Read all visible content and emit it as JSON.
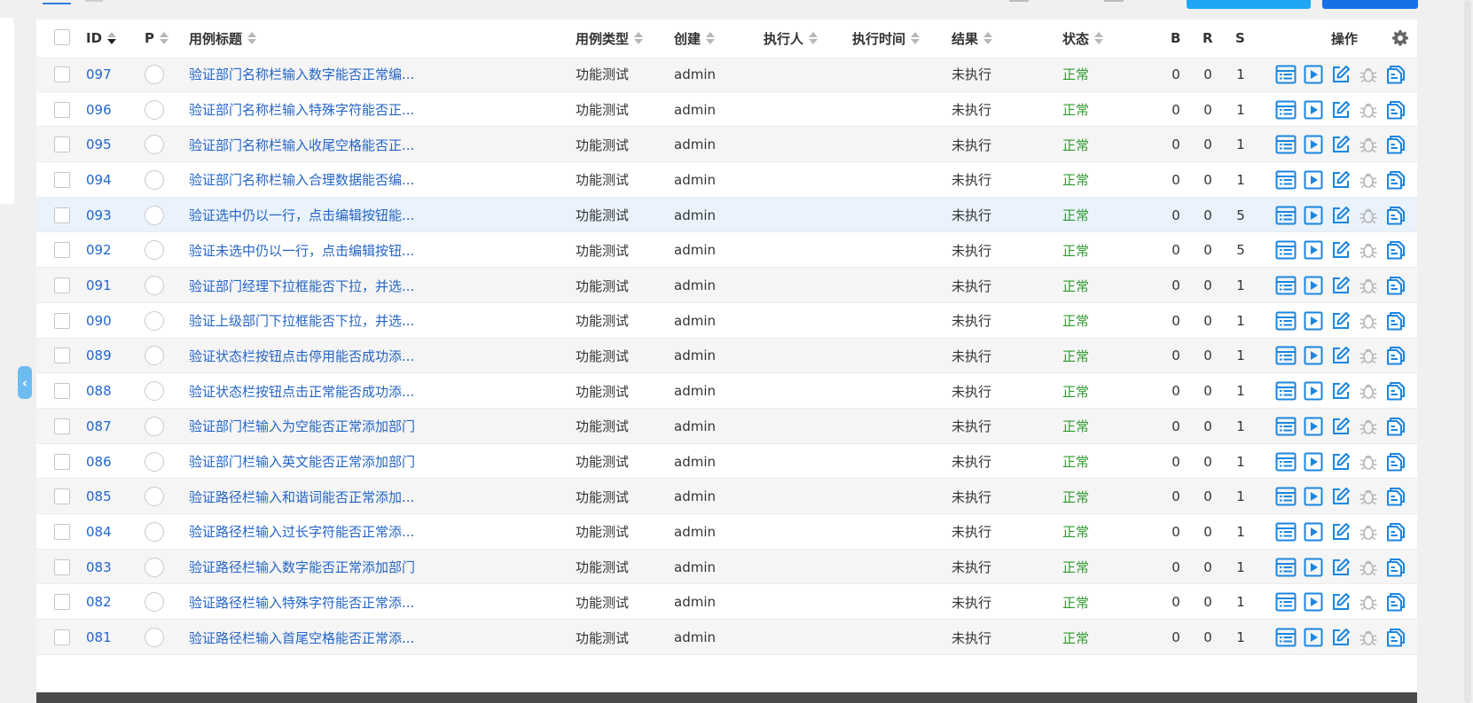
{
  "table": {
    "headers": {
      "id": "ID",
      "priority": "P",
      "title": "用例标题",
      "type": "用例类型",
      "creator": "创建",
      "executor": "执行人",
      "exec_time": "执行时间",
      "result": "结果",
      "status": "状态",
      "b": "B",
      "r": "R",
      "s": "S",
      "actions": "操作"
    },
    "rows": [
      {
        "id": "097",
        "title": "验证部门名称栏输入数字能否正常编...",
        "type": "功能测试",
        "creator": "admin",
        "executor": "",
        "exec_time": "",
        "result": "未执行",
        "status": "正常",
        "b": "0",
        "r": "0",
        "s": "1"
      },
      {
        "id": "096",
        "title": "验证部门名称栏输入特殊字符能否正...",
        "type": "功能测试",
        "creator": "admin",
        "executor": "",
        "exec_time": "",
        "result": "未执行",
        "status": "正常",
        "b": "0",
        "r": "0",
        "s": "1"
      },
      {
        "id": "095",
        "title": "验证部门名称栏输入收尾空格能否正...",
        "type": "功能测试",
        "creator": "admin",
        "executor": "",
        "exec_time": "",
        "result": "未执行",
        "status": "正常",
        "b": "0",
        "r": "0",
        "s": "1"
      },
      {
        "id": "094",
        "title": "验证部门名称栏输入合理数据能否编...",
        "type": "功能测试",
        "creator": "admin",
        "executor": "",
        "exec_time": "",
        "result": "未执行",
        "status": "正常",
        "b": "0",
        "r": "0",
        "s": "1"
      },
      {
        "id": "093",
        "title": "验证选中仍以一行，点击编辑按钮能...",
        "type": "功能测试",
        "creator": "admin",
        "executor": "",
        "exec_time": "",
        "result": "未执行",
        "status": "正常",
        "b": "0",
        "r": "0",
        "s": "5"
      },
      {
        "id": "092",
        "title": "验证未选中仍以一行，点击编辑按钮...",
        "type": "功能测试",
        "creator": "admin",
        "executor": "",
        "exec_time": "",
        "result": "未执行",
        "status": "正常",
        "b": "0",
        "r": "0",
        "s": "5"
      },
      {
        "id": "091",
        "title": "验证部门经理下拉框能否下拉，并选...",
        "type": "功能测试",
        "creator": "admin",
        "executor": "",
        "exec_time": "",
        "result": "未执行",
        "status": "正常",
        "b": "0",
        "r": "0",
        "s": "1"
      },
      {
        "id": "090",
        "title": "验证上级部门下拉框能否下拉，并选...",
        "type": "功能测试",
        "creator": "admin",
        "executor": "",
        "exec_time": "",
        "result": "未执行",
        "status": "正常",
        "b": "0",
        "r": "0",
        "s": "1"
      },
      {
        "id": "089",
        "title": "验证状态栏按钮点击停用能否成功添...",
        "type": "功能测试",
        "creator": "admin",
        "executor": "",
        "exec_time": "",
        "result": "未执行",
        "status": "正常",
        "b": "0",
        "r": "0",
        "s": "1"
      },
      {
        "id": "088",
        "title": "验证状态栏按钮点击正常能否成功添...",
        "type": "功能测试",
        "creator": "admin",
        "executor": "",
        "exec_time": "",
        "result": "未执行",
        "status": "正常",
        "b": "0",
        "r": "0",
        "s": "1"
      },
      {
        "id": "087",
        "title": "验证部门栏输入为空能否正常添加部门",
        "type": "功能测试",
        "creator": "admin",
        "executor": "",
        "exec_time": "",
        "result": "未执行",
        "status": "正常",
        "b": "0",
        "r": "0",
        "s": "1"
      },
      {
        "id": "086",
        "title": "验证部门栏输入英文能否正常添加部门",
        "type": "功能测试",
        "creator": "admin",
        "executor": "",
        "exec_time": "",
        "result": "未执行",
        "status": "正常",
        "b": "0",
        "r": "0",
        "s": "1"
      },
      {
        "id": "085",
        "title": "验证路径栏输入和谐词能否正常添加...",
        "type": "功能测试",
        "creator": "admin",
        "executor": "",
        "exec_time": "",
        "result": "未执行",
        "status": "正常",
        "b": "0",
        "r": "0",
        "s": "1"
      },
      {
        "id": "084",
        "title": "验证路径栏输入过长字符能否正常添...",
        "type": "功能测试",
        "creator": "admin",
        "executor": "",
        "exec_time": "",
        "result": "未执行",
        "status": "正常",
        "b": "0",
        "r": "0",
        "s": "1"
      },
      {
        "id": "083",
        "title": "验证路径栏输入数字能否正常添加部门",
        "type": "功能测试",
        "creator": "admin",
        "executor": "",
        "exec_time": "",
        "result": "未执行",
        "status": "正常",
        "b": "0",
        "r": "0",
        "s": "1"
      },
      {
        "id": "082",
        "title": "验证路径栏输入特殊字符能否正常添...",
        "type": "功能测试",
        "creator": "admin",
        "executor": "",
        "exec_time": "",
        "result": "未执行",
        "status": "正常",
        "b": "0",
        "r": "0",
        "s": "1"
      },
      {
        "id": "081",
        "title": "验证路径栏输入首尾空格能否正常添...",
        "type": "功能测试",
        "creator": "admin",
        "executor": "",
        "exec_time": "",
        "result": "未执行",
        "status": "正常",
        "b": "0",
        "r": "0",
        "s": "1"
      }
    ],
    "highlighted_row_id": "093",
    "row_action_icons": [
      "list-detail-icon",
      "run-play-icon",
      "edit-pencil-icon",
      "bug-icon",
      "copy-icon"
    ]
  },
  "colors": {
    "link": "#2565c6",
    "status_ok": "#2f9b2f",
    "icon_blue": "#1b86e0",
    "icon_disabled": "#b8b8b8",
    "collapse_button": "#6cbcf2",
    "top_button_cyan": "#1ea7f5",
    "top_button_blue": "#1670e8"
  }
}
